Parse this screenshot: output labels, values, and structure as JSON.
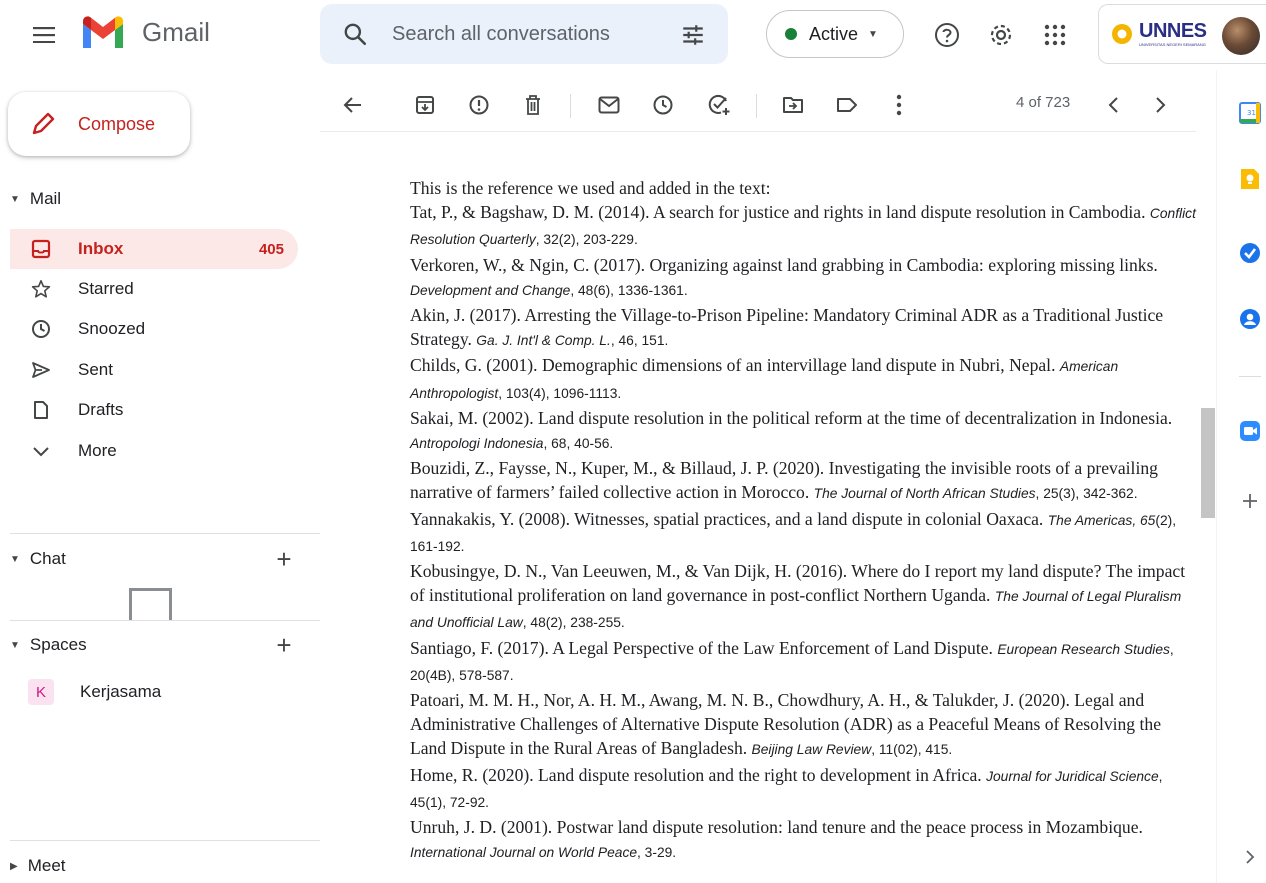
{
  "app": {
    "name": "Gmail"
  },
  "search": {
    "placeholder": "Search all conversations"
  },
  "status": {
    "label": "Active"
  },
  "account": {
    "org": "UNNES",
    "org_sub": "UNIVERSITAS NEGERI SEMARANG"
  },
  "compose": {
    "label": "Compose"
  },
  "mail_section": {
    "label": "Mail"
  },
  "nav": [
    {
      "label": "Inbox",
      "count": "405",
      "icon": "inbox-icon"
    },
    {
      "label": "Starred",
      "icon": "star-icon"
    },
    {
      "label": "Snoozed",
      "icon": "clock-icon"
    },
    {
      "label": "Sent",
      "icon": "send-icon"
    },
    {
      "label": "Drafts",
      "icon": "draft-icon"
    },
    {
      "label": "More",
      "icon": "chevron-down-icon"
    }
  ],
  "chat_section": {
    "label": "Chat"
  },
  "spaces_section": {
    "label": "Spaces"
  },
  "spaces": [
    {
      "badge": "K",
      "label": "Kerjasama"
    }
  ],
  "meet_section": {
    "label": "Meet"
  },
  "pager": {
    "text": "4 of 723"
  },
  "message": {
    "intro": "This is the reference we used and added in the text:",
    "refs": [
      {
        "main": "Tat, P., & Bagshaw, D. M. (2014). A search for justice and rights in land dispute resolution in Cambodia. ",
        "src": "Conflict Resolution Quarterly",
        "tail": ", 32(2), 203-229."
      },
      {
        "main": "Verkoren, W., & Ngin, C. (2017). Organizing against land grabbing in Cambodia: exploring missing links. ",
        "src": "Development and Change",
        "tail": ", 48(6), 1336-1361."
      },
      {
        "main": "Akin, J. (2017). Arresting the Village-to-Prison Pipeline: Mandatory Criminal ADR as a Traditional Justice Strategy. ",
        "src": "Ga. J. Int'l & Comp. L.",
        "tail": ", 46, 151."
      },
      {
        "main": "Childs, G. (2001). Demographic dimensions of an intervillage land dispute in Nubri, Nepal. ",
        "src": "American Anthropologist",
        "tail": ", 103(4), 1096-1113."
      },
      {
        "main": "Sakai, M. (2002). Land dispute resolution in the political reform at the time of decentralization in Indonesia. ",
        "src": "Antropologi Indonesia",
        "tail": ", 68, 40-56."
      },
      {
        "main": "Bouzidi, Z., Faysse, N., Kuper, M., & Billaud, J. P. (2020). Investigating the invisible roots of a prevailing narrative of farmers’ failed collective action in Morocco. ",
        "src": "The Journal of North African Studies",
        "tail": ", 25(3), 342-362."
      },
      {
        "main": "Yannakakis, Y. (2008). Witnesses, spatial practices, and a land dispute in colonial Oaxaca. ",
        "src": "The Americas, 65",
        "tail": "(2), 161-192."
      },
      {
        "main": "Kobusingye, D. N., Van Leeuwen, M., & Van Dijk, H. (2016). Where do I report my land dispute? The impact of institutional proliferation on land governance in post-conflict Northern Uganda. ",
        "src": "The Journal of Legal Pluralism and Unofficial Law",
        "tail": ", 48(2), 238-255."
      },
      {
        "main": "Santiago, F. (2017). A Legal Perspective of the Law Enforcement of Land Dispute. ",
        "src": "European Research Studies",
        "tail": ", 20(4B), 578-587."
      },
      {
        "main": "Patoari, M. M. H., Nor, A. H. M., Awang, M. N. B., Chowdhury, A. H., & Talukder, J. (2020). Legal and Administrative Challenges of Alternative Dispute Resolution (ADR) as a Peaceful Means of Resolving the Land Dispute in the Rural Areas of Bangladesh. ",
        "src": "Beijing Law Review",
        "tail": ", 11(02), 415."
      },
      {
        "main": "Home, R. (2020). Land dispute resolution and the right to development in Africa. ",
        "src": "Journal for Juridical Science",
        "tail": ", 45(1), 72-92."
      },
      {
        "main": "Unruh, J. D. (2001). Postwar land dispute resolution: land tenure and the peace process in Mozambique. ",
        "src": "International Journal on World Peace",
        "tail": ", 3-29."
      }
    ]
  },
  "colors": {
    "accent": "#c5221f",
    "active": "#188038",
    "search_bg": "#eaf1fb",
    "inbox_bg": "#fce8e6"
  }
}
